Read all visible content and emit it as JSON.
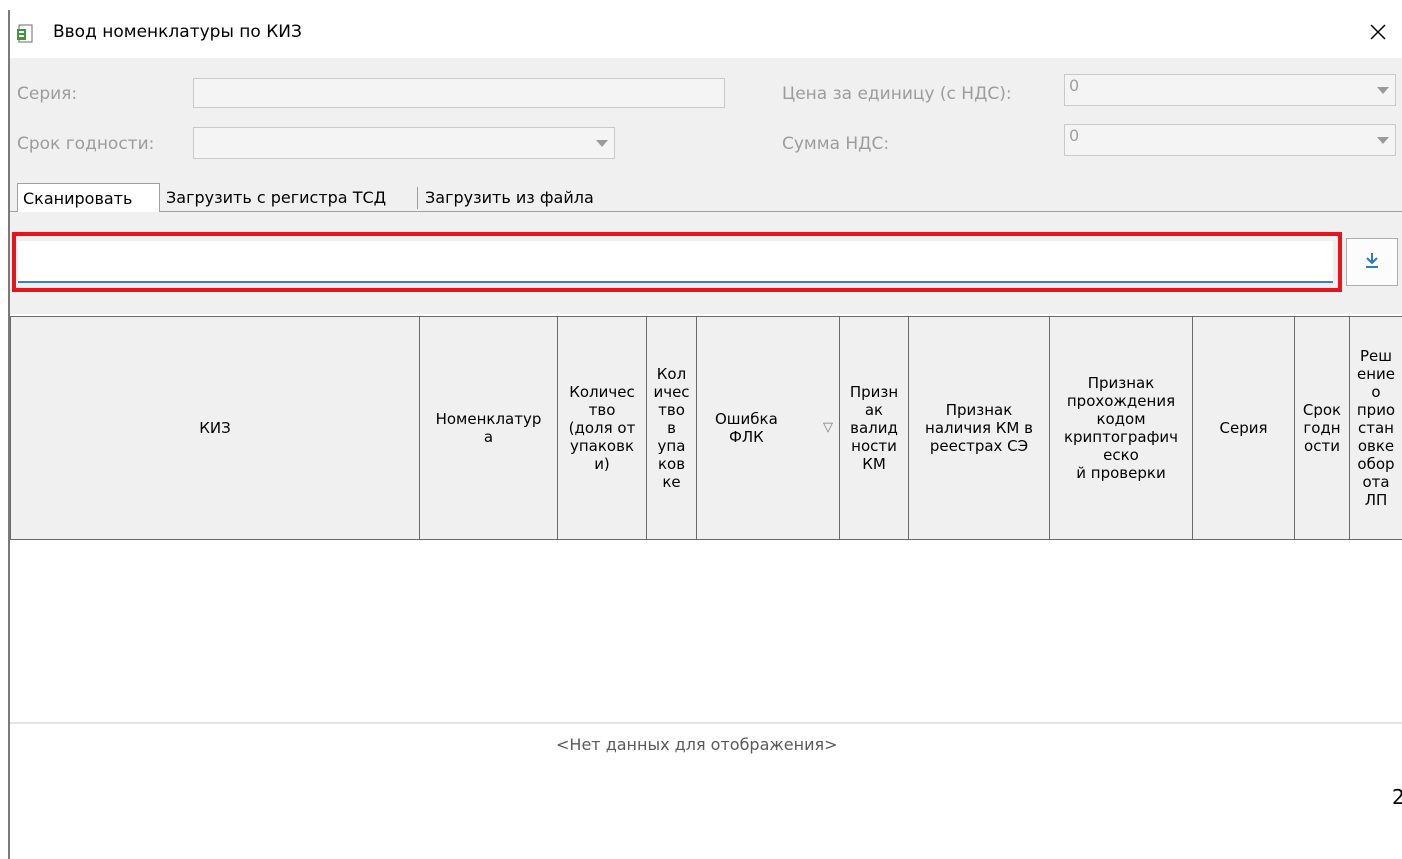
{
  "window": {
    "title": "Ввод номенклатуры по КИЗ",
    "icon": "document-icon",
    "close_label": "✕"
  },
  "form": {
    "series_label": "Серия:",
    "series_value": "",
    "expiry_label": "Срок годности:",
    "expiry_value": "",
    "price_label": "Цена за единицу (с НДС):",
    "price_value": "0",
    "vat_label": "Сумма НДС:",
    "vat_value": "0"
  },
  "tabs": [
    {
      "label": "Сканировать",
      "active": true
    },
    {
      "label": "Загрузить с регистра ТСД",
      "active": false
    },
    {
      "label": "Загрузить из файла",
      "active": false
    }
  ],
  "scan": {
    "input_value": "",
    "load_icon": "download-icon"
  },
  "table": {
    "columns": [
      {
        "lines": [
          "КИЗ"
        ]
      },
      {
        "lines": [
          "Номенклатур",
          "а"
        ]
      },
      {
        "lines": [
          "Количес",
          "тво",
          "(доля от",
          "упаковк",
          "и)"
        ]
      },
      {
        "lines": [
          "Кол",
          "ичес",
          "тво",
          "в",
          "упа",
          "ков",
          "ке"
        ]
      },
      {
        "lines": [
          "Ошибка",
          "ФЛК"
        ]
      },
      {
        "lines": [
          "Призн",
          "ак",
          "валид",
          "ности",
          "КМ"
        ]
      },
      {
        "lines": [
          "Признак",
          "наличия КМ в",
          "реестрах СЭ"
        ]
      },
      {
        "lines": [
          "Признак",
          "прохождения",
          "кодом",
          "криптографич",
          "еско",
          "й проверки"
        ]
      },
      {
        "lines": [
          "Серия"
        ]
      },
      {
        "lines": [
          "Срок",
          "годн",
          "ости"
        ]
      },
      {
        "lines": [
          "Реш",
          "ение",
          "о",
          "прио",
          "стан",
          "овке",
          "обор",
          "ота",
          "ЛП"
        ]
      }
    ],
    "sort_icon": "▽",
    "empty_text": "<Нет данных для отображения>"
  },
  "footer": {
    "page_fragment": "2"
  },
  "colors": {
    "highlight": "#e8141c",
    "input_underline": "#3c7fd0",
    "panel_bg": "#f0f0f0"
  }
}
